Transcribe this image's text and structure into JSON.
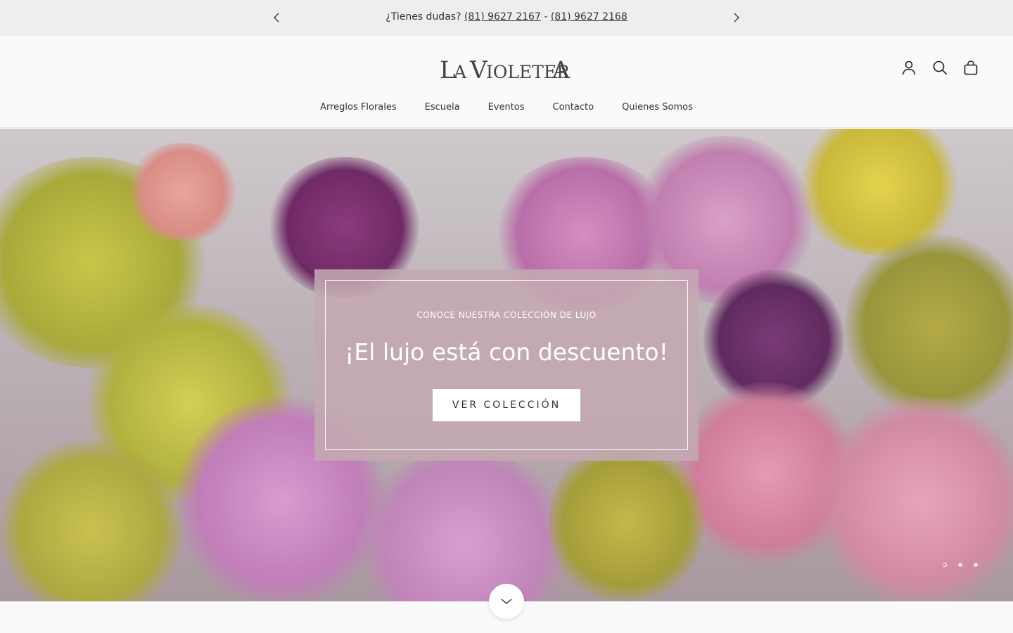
{
  "announcement": {
    "prefix": "¿Tienes dudas?",
    "phone1": "(81) 9627 2167",
    "separator": " - ",
    "phone2": "(81) 9627 2168"
  },
  "brand": {
    "name": "LA VIOLETERA"
  },
  "nav": {
    "items": [
      "Arreglos Florales",
      "Escuela",
      "Eventos",
      "Contacto",
      "Quienes Somos"
    ]
  },
  "header_icons": [
    "account-icon",
    "search-icon",
    "bag-icon"
  ],
  "hero": {
    "kicker": "CONOCE NUESTRA COLECCIÓN DE LUJO",
    "headline": "¡El lujo está con descuento!",
    "cta": "VER COLECCIÓN",
    "slides": 3,
    "active_slide": 1
  },
  "colors": {
    "announce_bg": "#efeeec",
    "card_bg": "#c4a8b2",
    "page_bg": "#fafafa"
  }
}
